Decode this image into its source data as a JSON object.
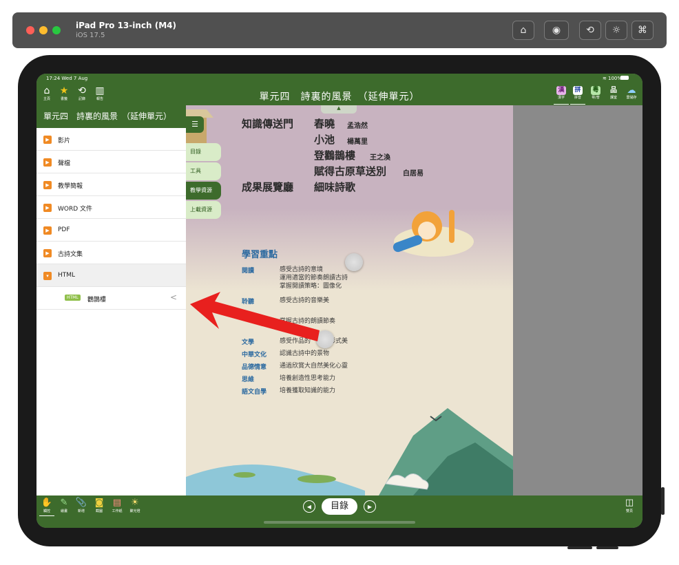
{
  "simulator": {
    "device_name": "iPad Pro 13-inch (M4)",
    "os_version": "iOS 17.5",
    "buttons": [
      "home-icon",
      "screenshot-icon",
      "rotate-icon",
      "appearance-icon",
      "keyboard-icon"
    ]
  },
  "status_bar": {
    "time_date": "17:24  Wed 7 Aug",
    "battery": "100%"
  },
  "top_nav": {
    "left_items": [
      {
        "icon": "home-icon",
        "label": "主頁"
      },
      {
        "icon": "bookmark-icon",
        "label": "書籤"
      },
      {
        "icon": "history-icon",
        "label": "記錄"
      },
      {
        "icon": "report-icon",
        "label": "報告"
      }
    ],
    "title": "單元四　詩裏的風景　（延伸單元）",
    "right_items": [
      {
        "icon": "hanzi-icon",
        "glyph": "漢",
        "label": "漢字"
      },
      {
        "icon": "pinyin-icon",
        "glyph": "拼",
        "label": "拼音"
      },
      {
        "icon": "cantonese-icon",
        "glyph": "粵",
        "label": "粵/普"
      },
      {
        "icon": "classroom-icon",
        "glyph": "品",
        "label": "課室"
      },
      {
        "icon": "cloud-icon",
        "glyph": "☁",
        "label": "雲儲存"
      }
    ]
  },
  "sidebar": {
    "header": "單元四　詩裏的風景　（延伸單元）",
    "items": [
      {
        "label": "影片"
      },
      {
        "label": "聲檔"
      },
      {
        "label": "教學簡報"
      },
      {
        "label": "WORD 文件"
      },
      {
        "label": "PDF"
      },
      {
        "label": "古詩文集"
      },
      {
        "label": "HTML"
      }
    ],
    "sub_item": {
      "badge": "HTML",
      "label": "鸛鵲樓"
    }
  },
  "side_tabs": [
    "目錄",
    "工具",
    "教學資源",
    "上載資源"
  ],
  "page": {
    "sections": [
      {
        "heading": "知識傳送門",
        "title": "春曉",
        "author": "孟浩然"
      },
      {
        "heading": "",
        "title": "小池",
        "author": "楊萬里"
      },
      {
        "heading": "",
        "title": "登鸛鵲樓",
        "author": "王之渙"
      },
      {
        "heading": "",
        "title": "賦得古原草送別",
        "author": "白居易"
      },
      {
        "heading": "成果展覽廳",
        "title": "細味詩歌",
        "author": ""
      }
    ],
    "objectives_title": "學習重點",
    "objectives": [
      {
        "label": "閱讀",
        "text": "感受古詩的意境\n運用適當的節奏朗讀古詩\n掌握閱讀策略：圖像化"
      },
      {
        "label": "聆聽",
        "text": "感受古詩的音樂美"
      },
      {
        "label": "",
        "text": "掌握古詩的朗讀節奏"
      },
      {
        "label": "文學",
        "text": "感受作品的　　和形式美"
      },
      {
        "label": "中華文化",
        "text": "認識古詩中的景物"
      },
      {
        "label": "品德情意",
        "text": "通過欣賞大自然美化心靈"
      },
      {
        "label": "思維",
        "text": "培養創造性思考能力"
      },
      {
        "label": "語文自學",
        "text": "培養獲取知識的能力"
      }
    ]
  },
  "bottom_bar": {
    "left_items": [
      {
        "icon": "hand-icon",
        "glyph": "✋",
        "label": "觸控"
      },
      {
        "icon": "pen-icon",
        "glyph": "✎",
        "label": "繪畫"
      },
      {
        "icon": "paperclip-icon",
        "glyph": "📎",
        "label": "新增"
      },
      {
        "icon": "camera-icon",
        "glyph": "◙",
        "label": "截圖"
      },
      {
        "icon": "worksheet-icon",
        "glyph": "▤",
        "label": "工作紙"
      },
      {
        "icon": "spotlight-icon",
        "glyph": "☀",
        "label": "聚光燈"
      }
    ],
    "toc_label": "目錄",
    "prev_icon": "chevron-left-icon",
    "next_icon": "chevron-right-icon",
    "right_label": "雙頁"
  },
  "colors": {
    "app_green": "#3d6b2c",
    "orange_icon": "#f08a24",
    "arrow_red": "#e8201e",
    "link_blue": "#2c6aa0"
  }
}
